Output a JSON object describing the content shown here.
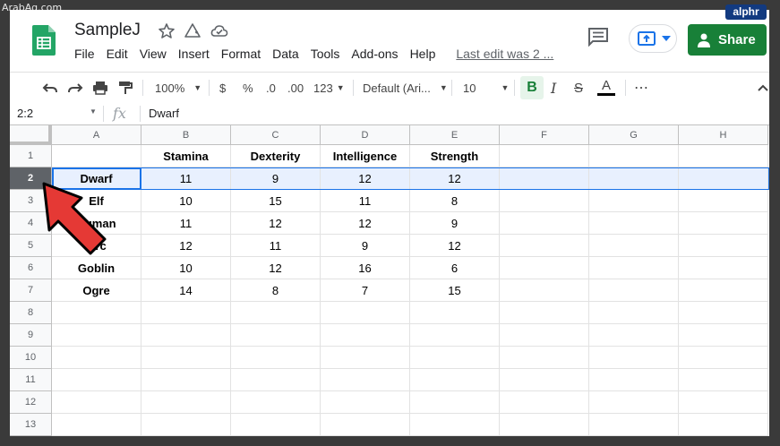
{
  "watermarks": {
    "left": "ArabAq.com",
    "right": "alphr"
  },
  "doc": {
    "title": "SampleJ",
    "menu": [
      "File",
      "Edit",
      "View",
      "Insert",
      "Format",
      "Data",
      "Tools",
      "Add-ons",
      "Help"
    ],
    "last_edit": "Last edit was 2 ...",
    "share_label": "Share"
  },
  "toolbar": {
    "zoom": "100%",
    "currency": "$",
    "percent": "%",
    "dec_decrease": ".0",
    "dec_increase": ".00",
    "more_formats": "123",
    "font": "Default (Ari...",
    "font_size": "10",
    "bold": "B",
    "italic": "I",
    "strike": "S",
    "text_color": "A",
    "more": "⋯"
  },
  "formula_bar": {
    "name_box": "2:2",
    "fx": "fx",
    "value": "Dwarf"
  },
  "colors": {
    "accent_green": "#188038",
    "selection_blue": "#1a73e8",
    "arrow_red": "#e53935"
  },
  "sheet": {
    "columns": [
      "A",
      "B",
      "C",
      "D",
      "E",
      "F",
      "G",
      "H"
    ],
    "rows": [
      "1",
      "2",
      "3",
      "4",
      "5",
      "6",
      "7",
      "8",
      "9",
      "10",
      "11",
      "12",
      "13"
    ],
    "selected_row": "2",
    "table": [
      [
        "",
        "Stamina",
        "Dexterity",
        "Intelligence",
        "Strength"
      ],
      [
        "Dwarf",
        "11",
        "9",
        "12",
        "12"
      ],
      [
        "Elf",
        "10",
        "15",
        "11",
        "8"
      ],
      [
        "Human",
        "11",
        "12",
        "12",
        "9"
      ],
      [
        "Orc",
        "12",
        "11",
        "9",
        "12"
      ],
      [
        "Goblin",
        "10",
        "12",
        "16",
        "6"
      ],
      [
        "Ogre",
        "14",
        "8",
        "7",
        "15"
      ]
    ]
  }
}
